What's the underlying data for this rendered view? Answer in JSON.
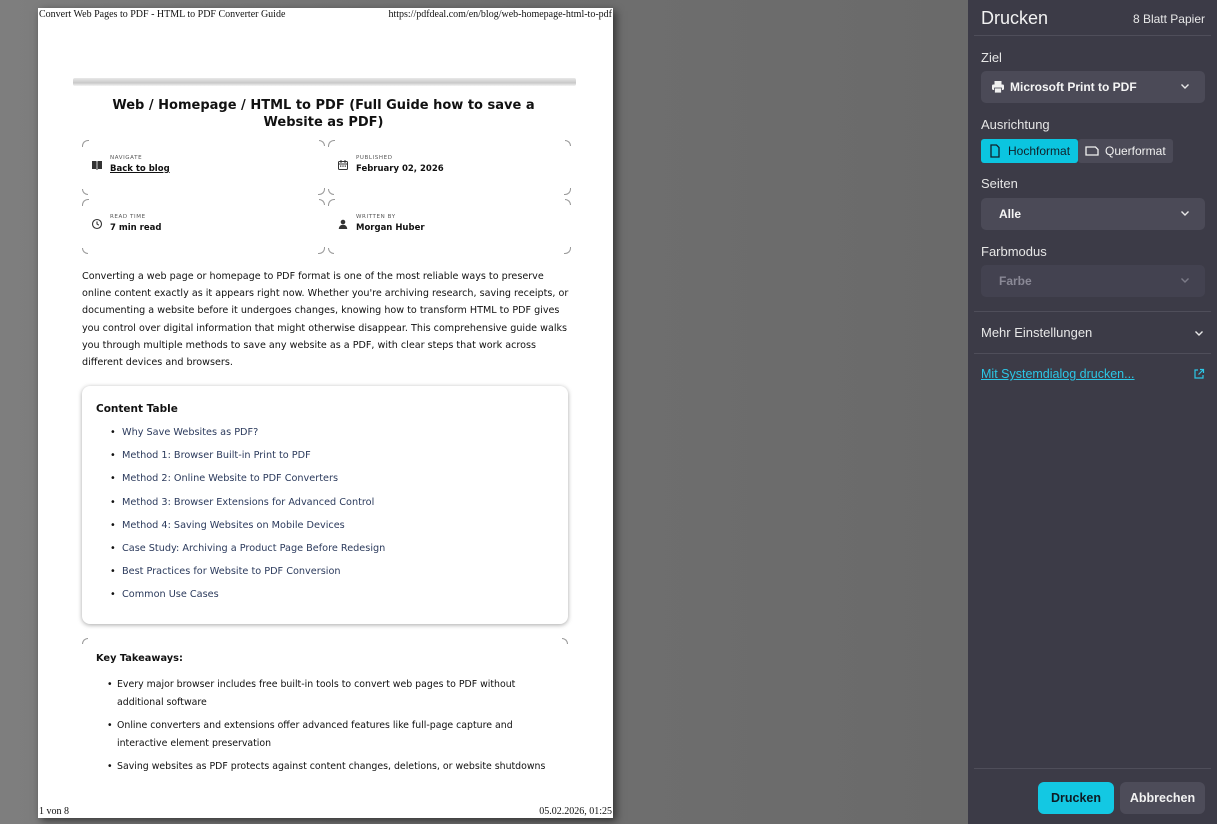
{
  "preview": {
    "header_title": "Convert Web Pages to PDF - HTML to PDF Converter Guide",
    "header_url": "https://pdfdeal.com/en/blog/web-homepage-html-to-pdf",
    "footer_page": "1 von 8",
    "footer_date": "05.02.2026, 01:25",
    "article": {
      "title": "Web / Homepage / HTML to PDF (Full Guide how to save a Website as PDF)",
      "meta": [
        {
          "label": "NAVIGATE",
          "value": "Back to blog",
          "icon": "book-icon"
        },
        {
          "label": "PUBLISHED",
          "value": "February 02, 2026",
          "icon": "calendar-icon"
        },
        {
          "label": "READ TIME",
          "value": "7 min read",
          "icon": "clock-icon"
        },
        {
          "label": "WRITTEN BY",
          "value": "Morgan Huber",
          "icon": "user-icon"
        }
      ],
      "intro": "Converting a web page or homepage to PDF format is one of the most reliable ways to preserve online content exactly as it appears right now. Whether you're archiving research, saving receipts, or documenting a website before it undergoes changes, knowing how to transform HTML to PDF gives you control over digital information that might otherwise disappear. This comprehensive guide walks you through multiple methods to save any website as a PDF, with clear steps that work across different devices and browsers.",
      "toc_title": "Content Table",
      "toc_items": [
        "Why Save Websites as PDF?",
        "Method 1: Browser Built-in Print to PDF",
        "Method 2: Online Website to PDF Converters",
        "Method 3: Browser Extensions for Advanced Control",
        "Method 4: Saving Websites on Mobile Devices",
        "Case Study: Archiving a Product Page Before Redesign",
        "Best Practices for Website to PDF Conversion",
        "Common Use Cases"
      ],
      "takeaways_title": "Key Takeaways:",
      "takeaways": [
        "Every major browser includes free built-in tools to convert web pages to PDF without additional software",
        "Online converters and extensions offer advanced features like full-page capture and interactive element preservation",
        "Saving websites as PDF protects against content changes, deletions, or website shutdowns"
      ]
    }
  },
  "panel": {
    "title": "Drucken",
    "sheet_count": "8 Blatt Papier",
    "destination_label": "Ziel",
    "destination_value": "Microsoft Print to PDF",
    "orientation_label": "Ausrichtung",
    "orientation_portrait": "Hochformat",
    "orientation_landscape": "Querformat",
    "orientation_selected": "Hochformat",
    "pages_label": "Seiten",
    "pages_value": "Alle",
    "color_label": "Farbmodus",
    "color_value": "Farbe",
    "more_settings": "Mehr Einstellungen",
    "system_dialog_link": "Mit Systemdialog drucken...",
    "print_button": "Drucken",
    "cancel_button": "Abbrechen",
    "accent_color": "#13c8e3",
    "panel_color": "#3c3b47"
  }
}
